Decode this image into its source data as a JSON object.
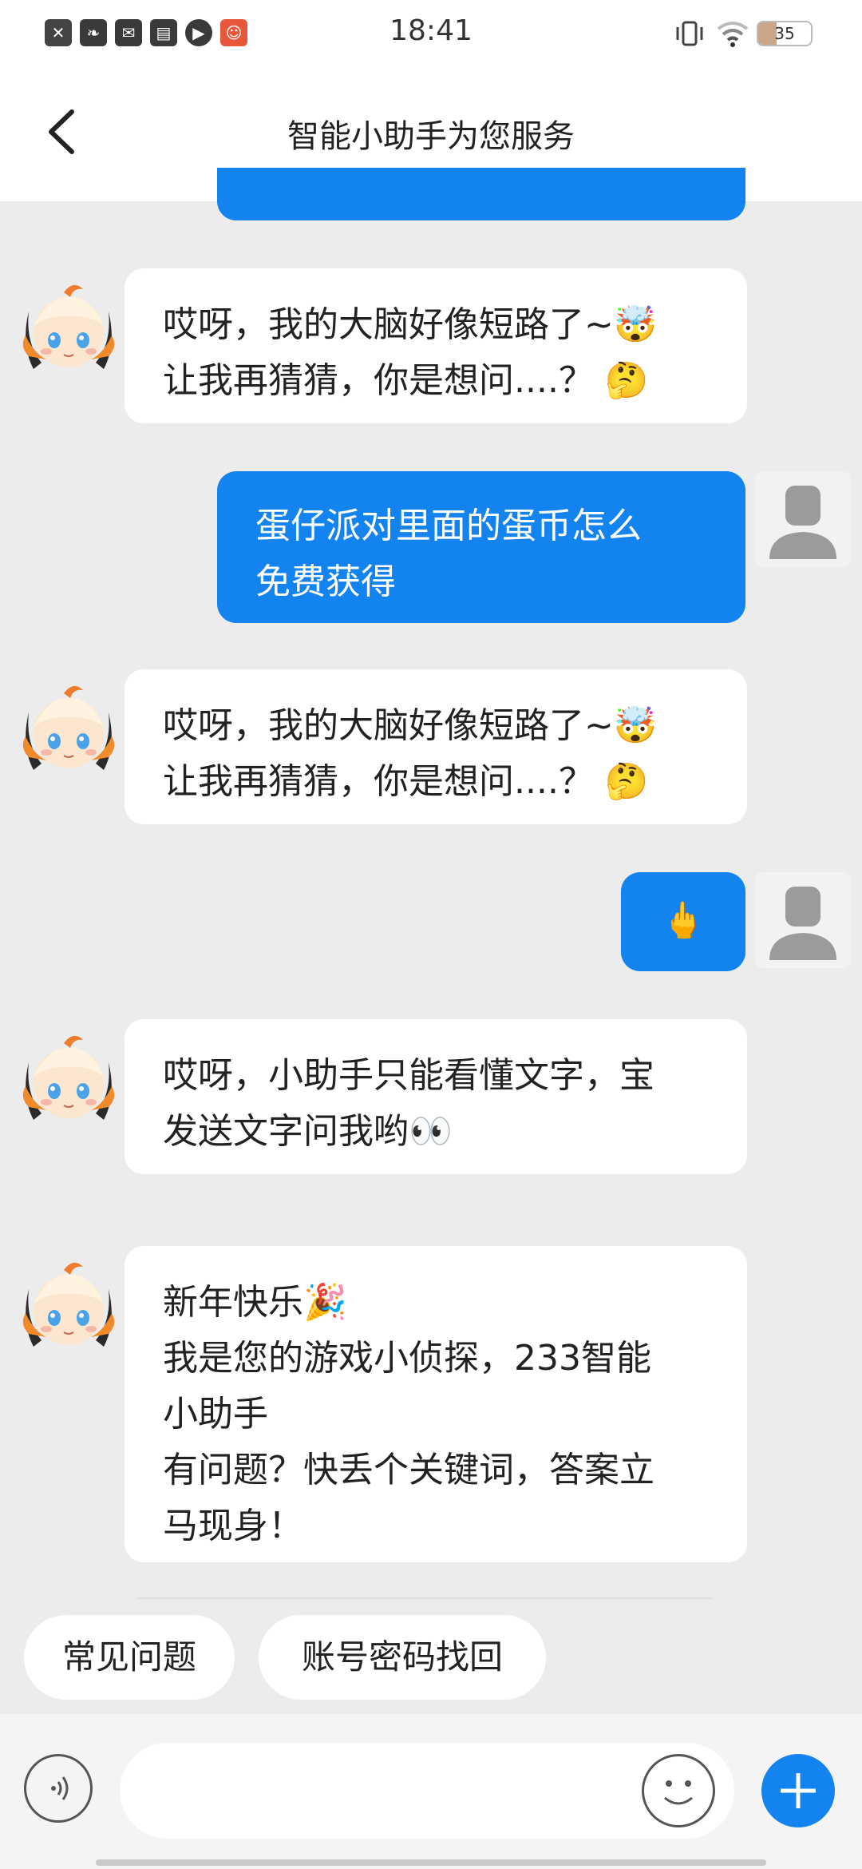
{
  "status_bar": {
    "time": "18:41",
    "battery": "35",
    "left_icons": [
      "sim-icon",
      "leaf-icon",
      "mail-icon",
      "book-icon",
      "play-icon",
      "app-icon"
    ],
    "right_icons": [
      "vibrate-icon",
      "wifi-icon",
      "battery-icon"
    ]
  },
  "header": {
    "title": "智能小助手为您服务",
    "back_icon": "back-arrow-icon"
  },
  "messages": [
    {
      "from": "bot",
      "lines": [
        "哎呀，我的大脑好像短路了~🤯",
        "让我再猜猜，你是想问....？ 🤔"
      ]
    },
    {
      "from": "user",
      "lines": [
        "蛋仔派对里面的蛋币怎么",
        "免费获得"
      ]
    },
    {
      "from": "bot",
      "lines": [
        "哎呀，我的大脑好像短路了~🤯",
        "让我再猜猜，你是想问....？ 🤔"
      ]
    },
    {
      "from": "user",
      "lines": [
        "🖕"
      ]
    },
    {
      "from": "bot",
      "lines": [
        "哎呀，小助手只能看懂文字，宝",
        "发送文字问我哟👀"
      ]
    },
    {
      "from": "bot",
      "lines": [
        "新年快乐🎉",
        "我是您的游戏小侦探，233智能",
        "小助手",
        "有问题？快丢个关键词，答案立",
        "马现身！"
      ]
    }
  ],
  "quick_replies": [
    "常见问题",
    "账号密码找回"
  ],
  "input_bar": {
    "voice_icon": "voice-icon",
    "emoji_icon": "smile-icon",
    "plus_icon": "plus-icon",
    "placeholder": ""
  },
  "colors": {
    "accent": "#1383f0",
    "background": "#ececec",
    "bubble_bot": "#ffffff"
  }
}
